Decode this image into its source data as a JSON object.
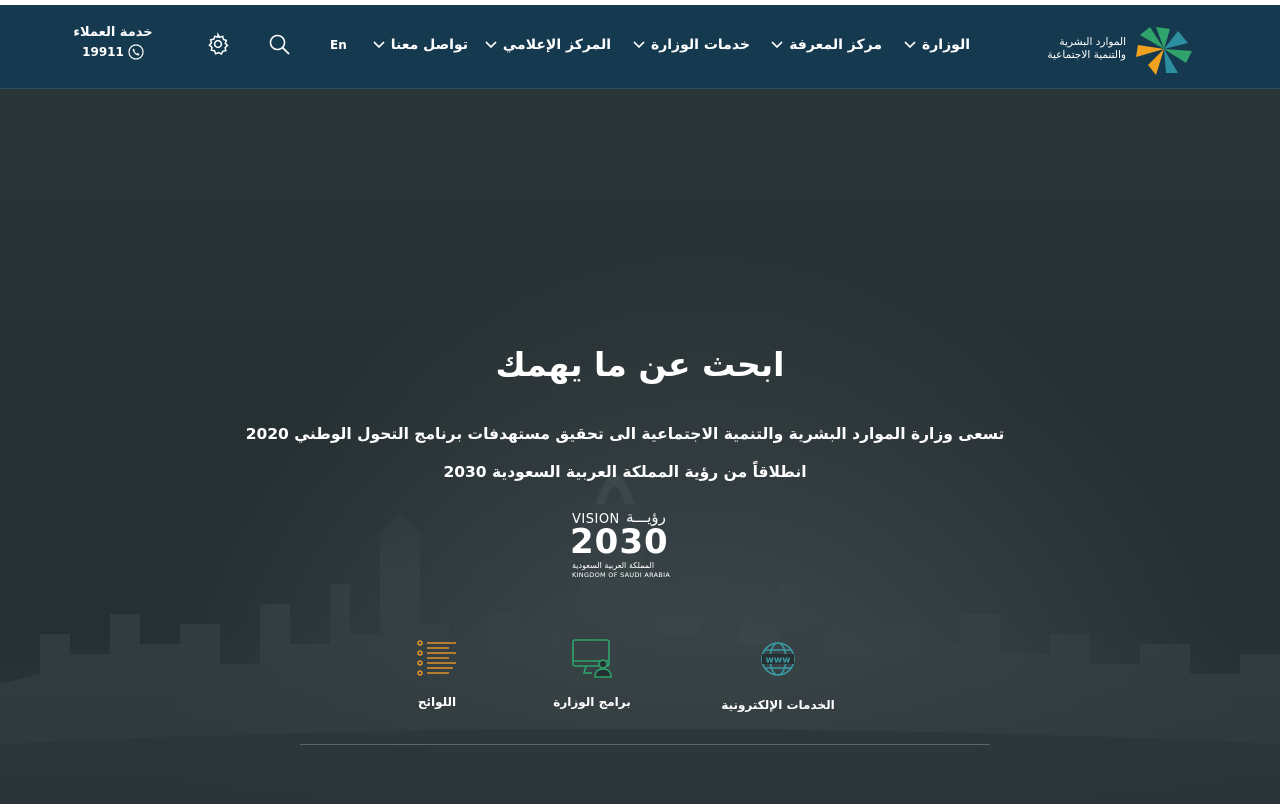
{
  "header": {
    "logo_text_line1": "الموارد البشرية",
    "logo_text_line2": "والتنمية الاجتماعية",
    "nav": [
      {
        "label": "الوزارة"
      },
      {
        "label": "مركز المعرفة"
      },
      {
        "label": "خدمات الوزارة"
      },
      {
        "label": "المركز الإعلامي"
      },
      {
        "label": "تواصل معنا"
      }
    ],
    "language_label": "En",
    "customer_service_title": "خدمة العملاء",
    "customer_service_number": "19911"
  },
  "hero": {
    "title": "ابحث عن ما يهمك",
    "description": "تسعى وزارة الموارد البشرية والتنمية الاجتماعية الى تحقيق مستهدفات برنامج التحول الوطني 2020 انطلاقاً من رؤية المملكة العربية السعودية 2030",
    "vision_logo": {
      "word": "VISION",
      "arabic": "رؤيـــة",
      "year": "2030",
      "sub_ar": "المملكة العربية السعودية",
      "sub_en": "KINGDOM OF SAUDI ARABIA"
    }
  },
  "quick_links": [
    {
      "label": "الخدمات الإلكترونية",
      "icon": "www-globe-icon",
      "color": "#3a9aa3"
    },
    {
      "label": "برامج الوزارة",
      "icon": "monitor-user-icon",
      "color": "#2fa36b"
    },
    {
      "label": "اللوائح",
      "icon": "list-icon",
      "color": "#e0912b"
    }
  ],
  "colors": {
    "navbar": "#15394f",
    "logo_green": "#2fa36b",
    "logo_orange": "#f0a21e",
    "logo_teal": "#2c8fa0"
  }
}
